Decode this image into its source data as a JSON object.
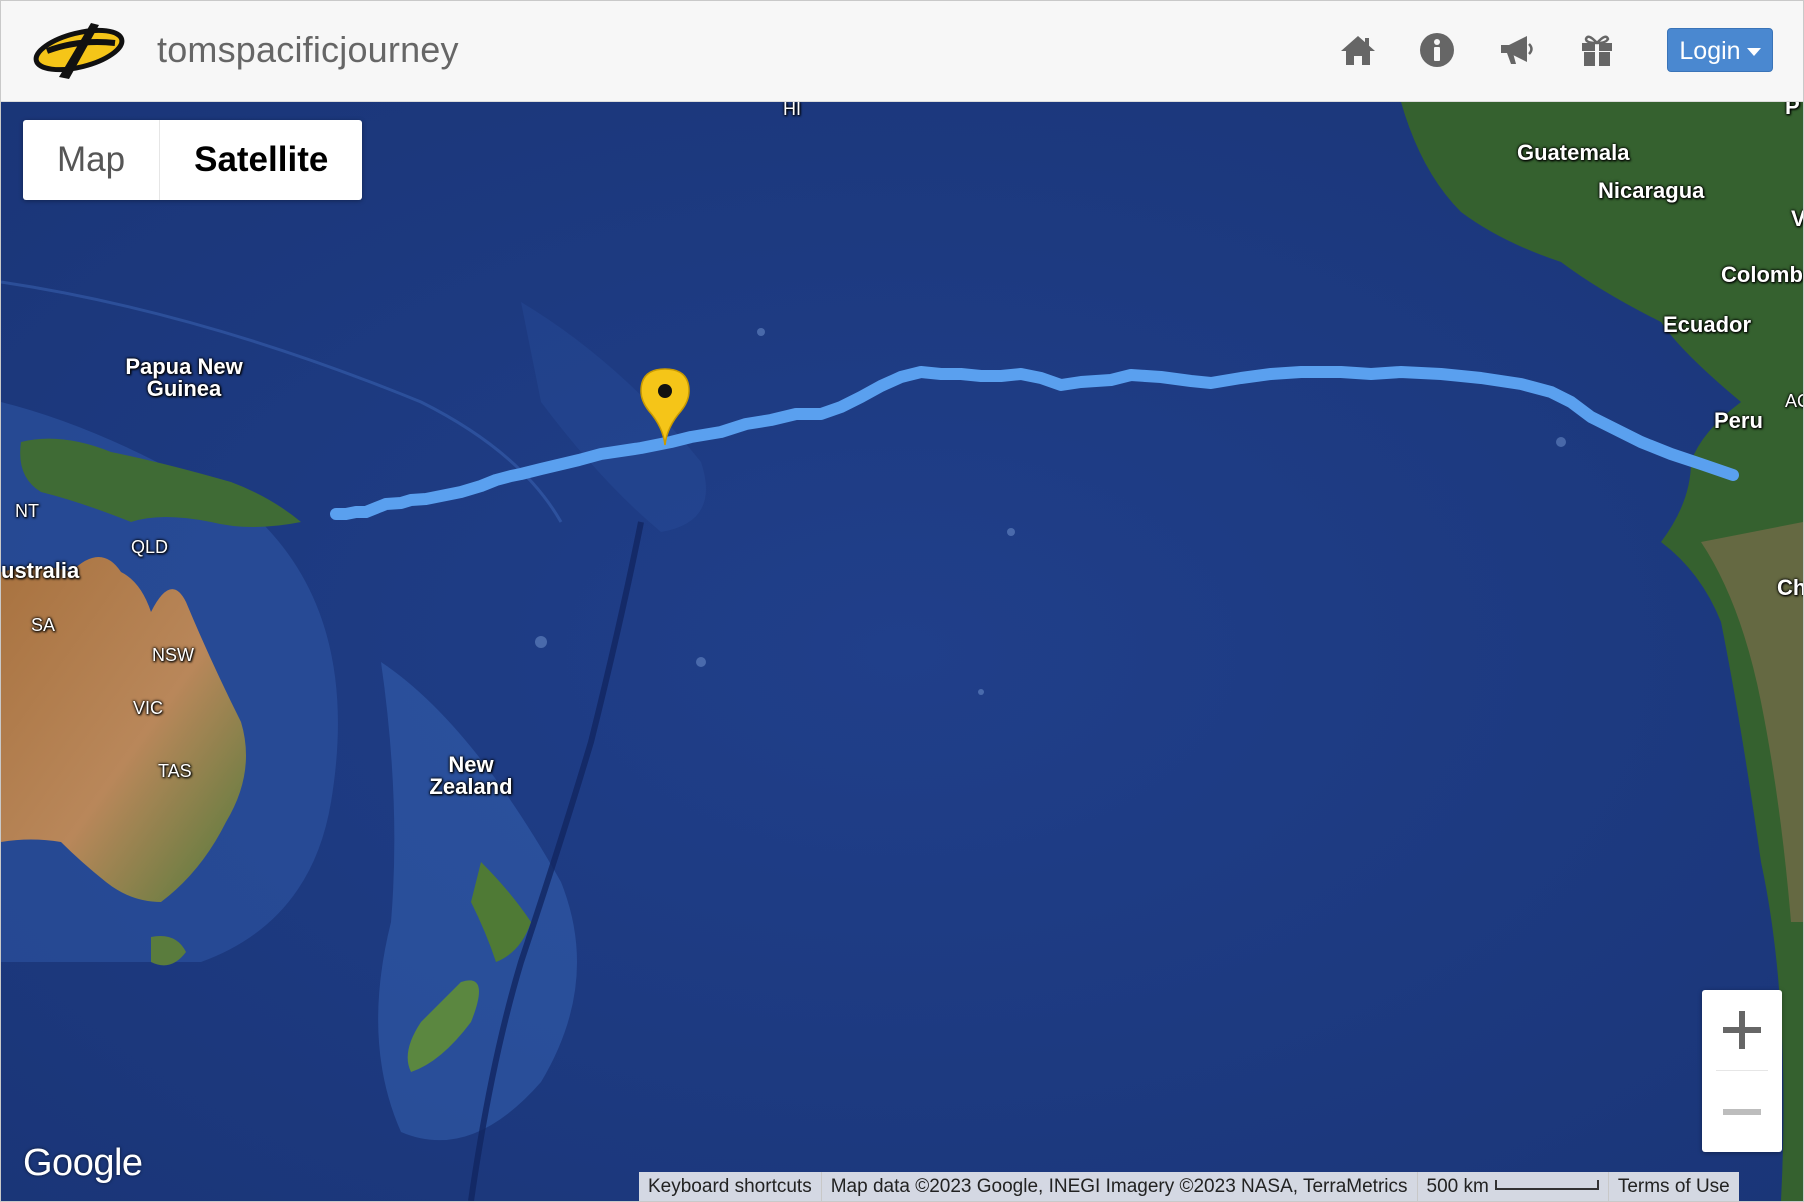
{
  "header": {
    "site_title": "tomspacificjourney",
    "login_label": "Login",
    "nav_icons": [
      "home-icon",
      "info-icon",
      "bullhorn-icon",
      "gift-icon"
    ]
  },
  "map": {
    "type_control": {
      "map_label": "Map",
      "satellite_label": "Satellite",
      "selected": "Satellite"
    },
    "labels": [
      "HI",
      "Guatemala",
      "Nicaragua",
      "Colomb",
      "Ecuador",
      "Peru",
      "Ch",
      "AC",
      "Papua New Guinea",
      "NT",
      "QLD",
      "ustralia",
      "SA",
      "NSW",
      "VIC",
      "TAS",
      "New Zealand",
      "P",
      "V"
    ],
    "route": {
      "color": "#5aa0ef",
      "from": "Peru",
      "marker_color": "#f5c518"
    },
    "zoom": {
      "in_label": "+",
      "out_label": "−"
    },
    "google_logo": "Google",
    "attribution": {
      "shortcuts": "Keyboard shortcuts",
      "data": "Map data ©2023 Google, INEGI Imagery ©2023 NASA, TerraMetrics",
      "scale": "500 km",
      "terms": "Terms of Use"
    }
  },
  "colors": {
    "ocean": "#1f3b85",
    "header_bg": "#f7f7f7",
    "login_bg": "#4a88d0",
    "route": "#5aa0ef",
    "marker": "#f5c518"
  }
}
